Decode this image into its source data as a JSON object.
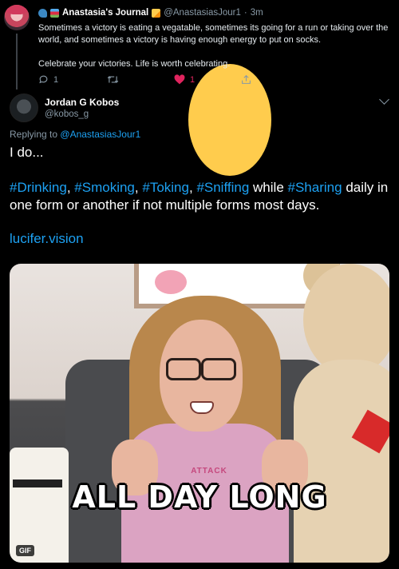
{
  "parent_tweet": {
    "display_name": "Anastasia's Journal",
    "handle": "@AnastasiasJour1",
    "separator": "·",
    "time": "3m",
    "text_line1": "Sometimes a victory is eating a vegatable, sometimes its going for a run or taking over the world, and sometimes a victory is having enough energy to put on socks.",
    "text_line2": "Celebrate your victories. Life is worth celebrating.",
    "reply_count": "1",
    "retweet_count": "",
    "like_count": "1",
    "icons": {
      "reply": "reply-icon",
      "retweet": "retweet-icon",
      "like": "heart-icon",
      "share": "share-icon"
    },
    "colors": {
      "like": "#e0245e",
      "muted": "#8899a6"
    }
  },
  "main_tweet": {
    "display_name": "Jordan G Kobos",
    "handle": "@kobos_g",
    "replying_prefix": "Replying to",
    "replying_to": "@AnastasiasJour1",
    "intro": "I do...",
    "hashtags": [
      "#Drinking",
      "#Smoking",
      "#Toking",
      "#Sniffing",
      "#Sharing"
    ],
    "separators": [
      ",",
      ",",
      ",",
      ""
    ],
    "connector": "while",
    "tail": "daily in one form or another if not multiple forms most days.",
    "link": "lucifer.vision",
    "colors": {
      "link": "#1da1f2",
      "text": "#ffffff"
    }
  },
  "media": {
    "caption": "ALL DAY LONG",
    "shirt_text": "ATTACK",
    "badge": "GIF"
  }
}
